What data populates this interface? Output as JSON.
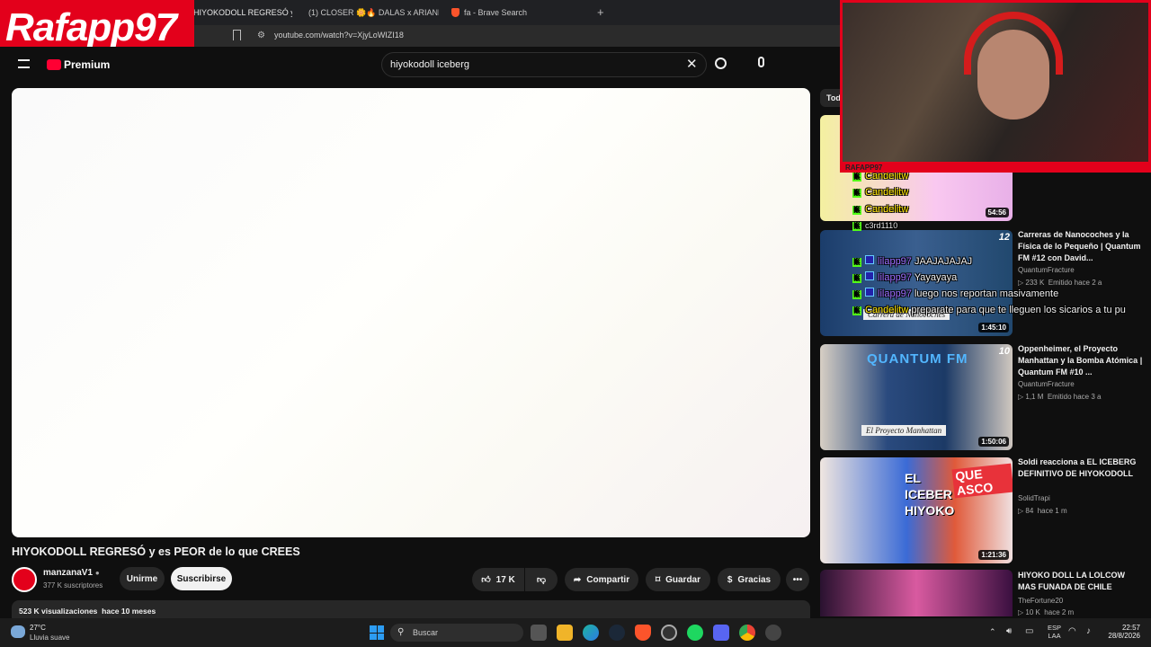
{
  "overlay": {
    "logo_text": "Rafapp97"
  },
  "browser": {
    "tabs": [
      {
        "label": "HIYOKODOLL REGRESÓ y es P"
      },
      {
        "label": "(1) CLOSER 🌼🔥 DALAS x ARIANN"
      },
      {
        "label": "fa - Brave Search"
      }
    ],
    "url": "youtube.com/watch?v=XjyLoWIZI18"
  },
  "youtube": {
    "logo_label": "Premium",
    "search_value": "hiyokodoll iceberg",
    "video": {
      "title": "HIYOKODOLL REGRESÓ y es PEOR de lo que CREES",
      "channel": "manzanaV1",
      "subscribers": "377 K suscriptores",
      "join_label": "Unirme",
      "subscribe_label": "Suscribirse",
      "likes": "17 K",
      "share_label": "Compartir",
      "save_label": "Guardar",
      "thanks_label": "Gracias",
      "views": "523 K visualizaciones",
      "age": "hace 10 meses"
    },
    "sidebar": {
      "chip": "Tod",
      "items": [
        {
          "duration": "54:56"
        },
        {
          "title": "Carreras de Nanocoches y la Física de lo Pequeño | Quantum FM #12 con David...",
          "channel": "QuantumFracture",
          "views": "233 K",
          "age": "Emitido hace 2 a",
          "duration": "1:45:10",
          "thumb_text": "Carrera de Nanocoches",
          "badge": "12"
        },
        {
          "title": "Oppenheimer, el Proyecto Manhattan y la Bomba Atómica | Quantum FM #10 ...",
          "channel": "QuantumFracture",
          "views": "1,1 M",
          "age": "Emitido hace 3 a",
          "duration": "1:50:06",
          "thumb_text": "El Proyecto Manhattan",
          "thumb_header": "QUANTUM FM",
          "badge": "10"
        },
        {
          "title": "Soldi reacciona a  EL ICEBERG DEFINITIVO DE HIYOKODOLL",
          "channel": "SolidTrapi",
          "views": "84",
          "age": "hace 1 m",
          "duration": "1:21:36",
          "thumb_text": "EL ICEBER HIYOKO",
          "thumb_stamp": "QUE ASCO"
        },
        {
          "title": "HIYOKO DOLL LA LOLCOW MAS FUNADA DE CHILE",
          "channel": "TheFortune20",
          "views": "10 K",
          "age": "hace 2 m"
        }
      ]
    }
  },
  "stream_chat": [
    {
      "user": "Candelitw",
      "msg": "",
      "color": "#ffe600"
    },
    {
      "user": "Candelitw",
      "msg": "",
      "color": "#ffe600"
    },
    {
      "user": "Candelitw",
      "msg": "",
      "color": "#ffe600"
    },
    {
      "user": "c3rd1110",
      "msg": "",
      "color": "#e0e0e0"
    },
    {
      "user": "lilapp97",
      "msg": "JAAJAJAJAJ",
      "color": "#9e6cff"
    },
    {
      "user": "lilapp97",
      "msg": "Yayayaya",
      "color": "#9e6cff"
    },
    {
      "user": "lilapp97",
      "msg": "luego nos reportan masivamente",
      "color": "#9e6cff"
    },
    {
      "user": "Candelitw",
      "msg": "preparate para que te lleguen los sicarios a tu pu",
      "color": "#ffe600"
    }
  ],
  "webcam": {
    "label": "RAFAPP97"
  },
  "taskbar": {
    "weather_temp": "27°C",
    "weather_desc": "Lluvia suave",
    "search_placeholder": "Buscar",
    "lang_top": "ESP",
    "lang_bottom": "LAA",
    "time": "22:57",
    "date": "28/8/2026"
  }
}
